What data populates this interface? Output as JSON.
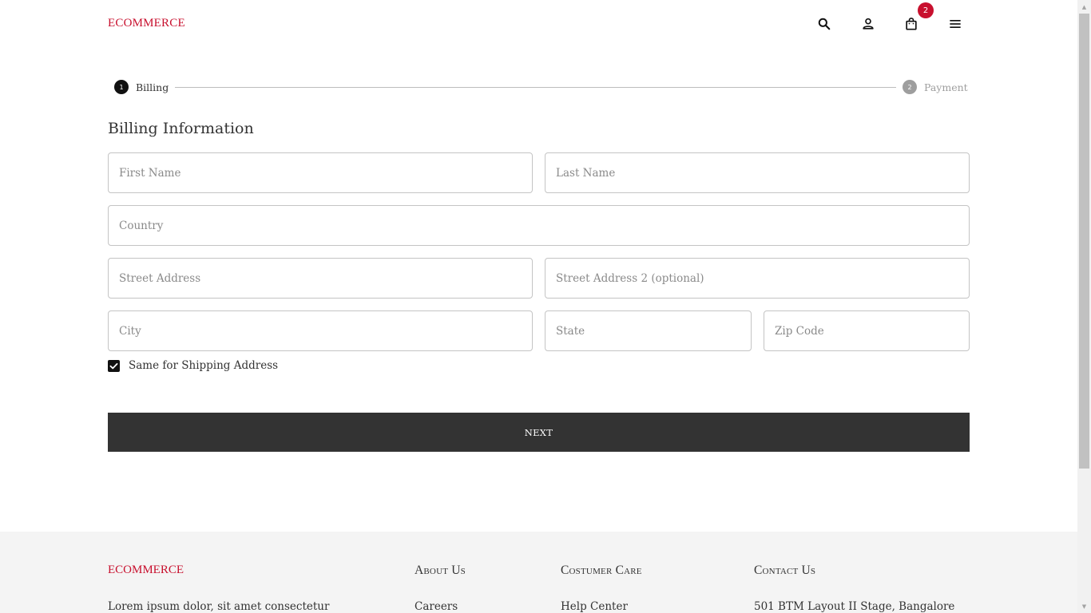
{
  "colors": {
    "brand": "#c8102e",
    "dark": "#333333",
    "step_active": "#111111",
    "step_inactive": "#9e9e9e",
    "badge": "#c8102e"
  },
  "header": {
    "logo": "ECOMMERCE",
    "icons": [
      "search-icon",
      "user-icon",
      "shopping-bag-icon",
      "menu-icon"
    ],
    "cart_count": "2"
  },
  "stepper": {
    "steps": [
      {
        "number": "1",
        "label": "Billing",
        "active": true
      },
      {
        "number": "2",
        "label": "Payment",
        "active": false
      }
    ]
  },
  "form": {
    "title": "Billing Information",
    "fields": {
      "first_name": {
        "placeholder": "First Name",
        "value": ""
      },
      "last_name": {
        "placeholder": "Last Name",
        "value": ""
      },
      "country": {
        "placeholder": "Country",
        "value": ""
      },
      "street_address": {
        "placeholder": "Street Address",
        "value": ""
      },
      "street_address_2": {
        "placeholder": "Street Address 2 (optional)",
        "value": ""
      },
      "city": {
        "placeholder": "City",
        "value": ""
      },
      "state": {
        "placeholder": "State",
        "value": ""
      },
      "zip": {
        "placeholder": "Zip Code",
        "value": ""
      }
    },
    "same_shipping": {
      "label": "Same for Shipping Address",
      "checked": true
    },
    "next_label": "NEXT"
  },
  "footer": {
    "logo": "ECOMMERCE",
    "about_text": "Lorem ipsum dolor, sit amet consectetur",
    "columns": [
      {
        "heading": "About Us",
        "first_item": "Careers"
      },
      {
        "heading": "Costumer Care",
        "first_item": "Help Center"
      },
      {
        "heading": "Contact Us",
        "first_item": "501 BTM Layout II Stage, Bangalore"
      }
    ]
  }
}
